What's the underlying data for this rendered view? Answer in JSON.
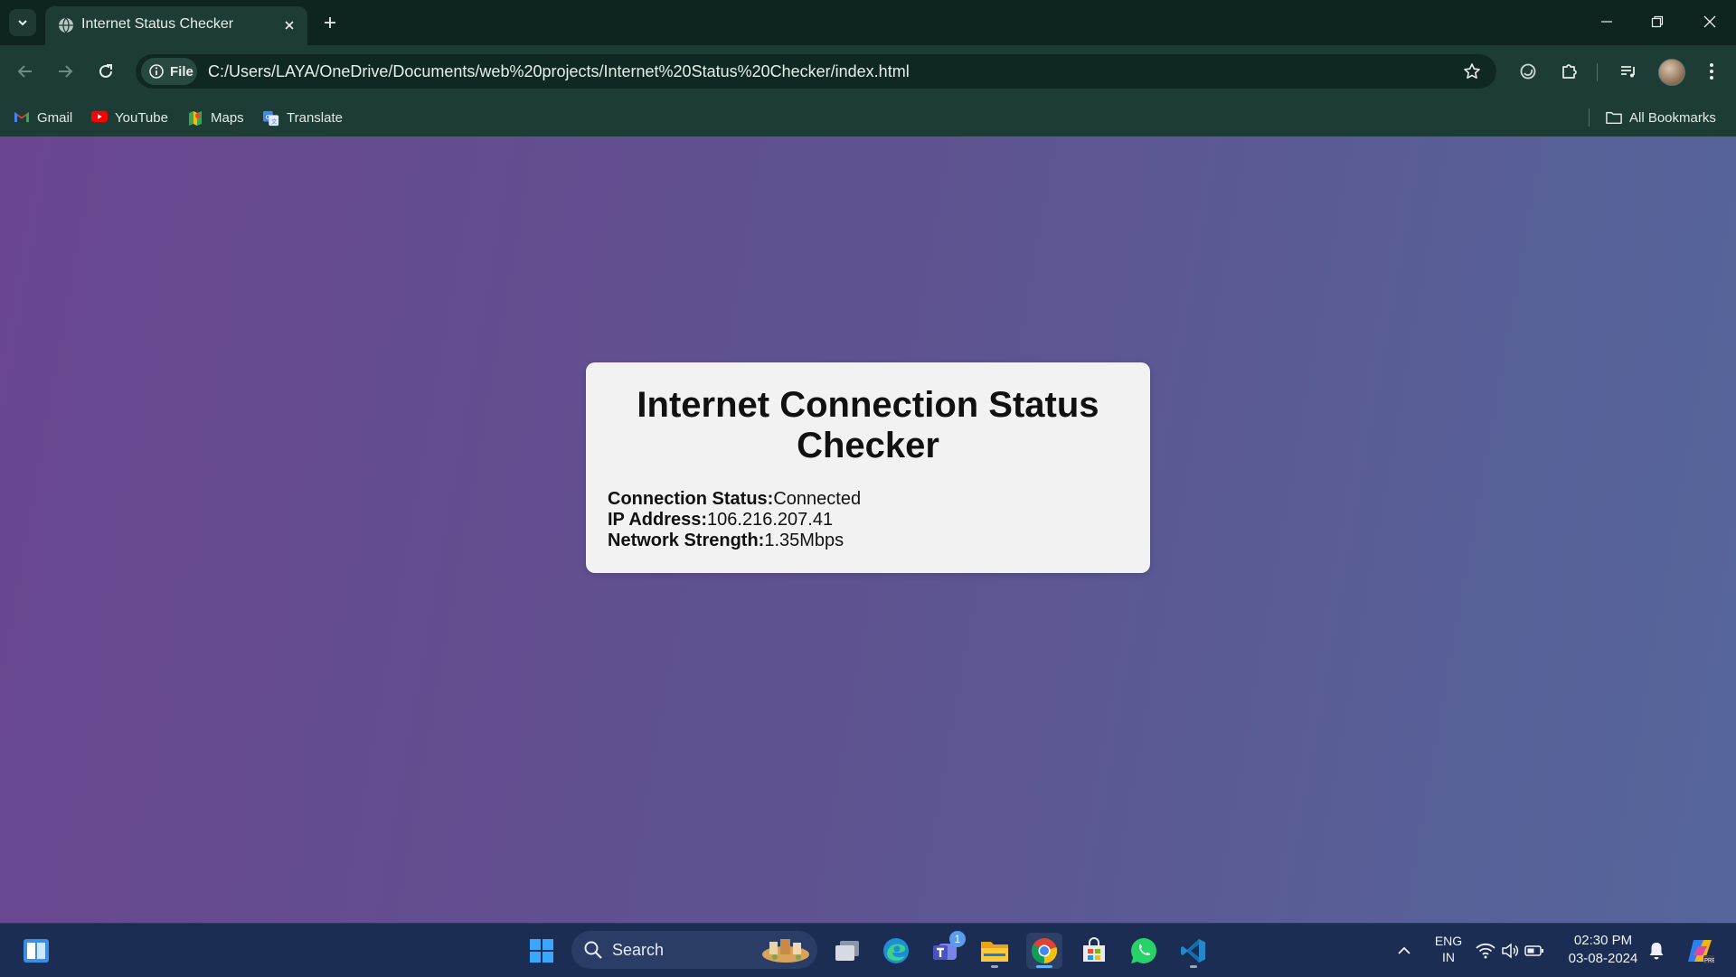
{
  "browser": {
    "tab": {
      "title": "Internet Status Checker"
    },
    "omnibox": {
      "chip_label": "File",
      "url": "C:/Users/LAYA/OneDrive/Documents/web%20projects/Internet%20Status%20Checker/index.html"
    },
    "bookmarks": [
      {
        "label": "Gmail",
        "icon": "gmail-icon"
      },
      {
        "label": "YouTube",
        "icon": "youtube-icon"
      },
      {
        "label": "Maps",
        "icon": "maps-icon"
      },
      {
        "label": "Translate",
        "icon": "translate-icon"
      }
    ],
    "all_bookmarks_label": "All Bookmarks"
  },
  "page": {
    "title": "Internet Connection Status Checker",
    "status": {
      "connection_label": "Connection Status:",
      "connection_value": "Connected",
      "ip_label": "IP Address:",
      "ip_value": "106.216.207.41",
      "strength_label": "Network Strength:",
      "strength_value": "1.35Mbps"
    }
  },
  "taskbar": {
    "search_label": "Search",
    "teams_badge": "1",
    "language": {
      "line1": "ENG",
      "line2": "IN"
    },
    "clock": {
      "time": "02:30 PM",
      "date": "03-08-2024"
    }
  },
  "colors": {
    "page_gradient_start": "#6a4690",
    "page_gradient_end": "#55669c",
    "card_background": "#f2f2f2",
    "browser_chrome": "#1e3c36",
    "taskbar": "#1b2d52"
  }
}
